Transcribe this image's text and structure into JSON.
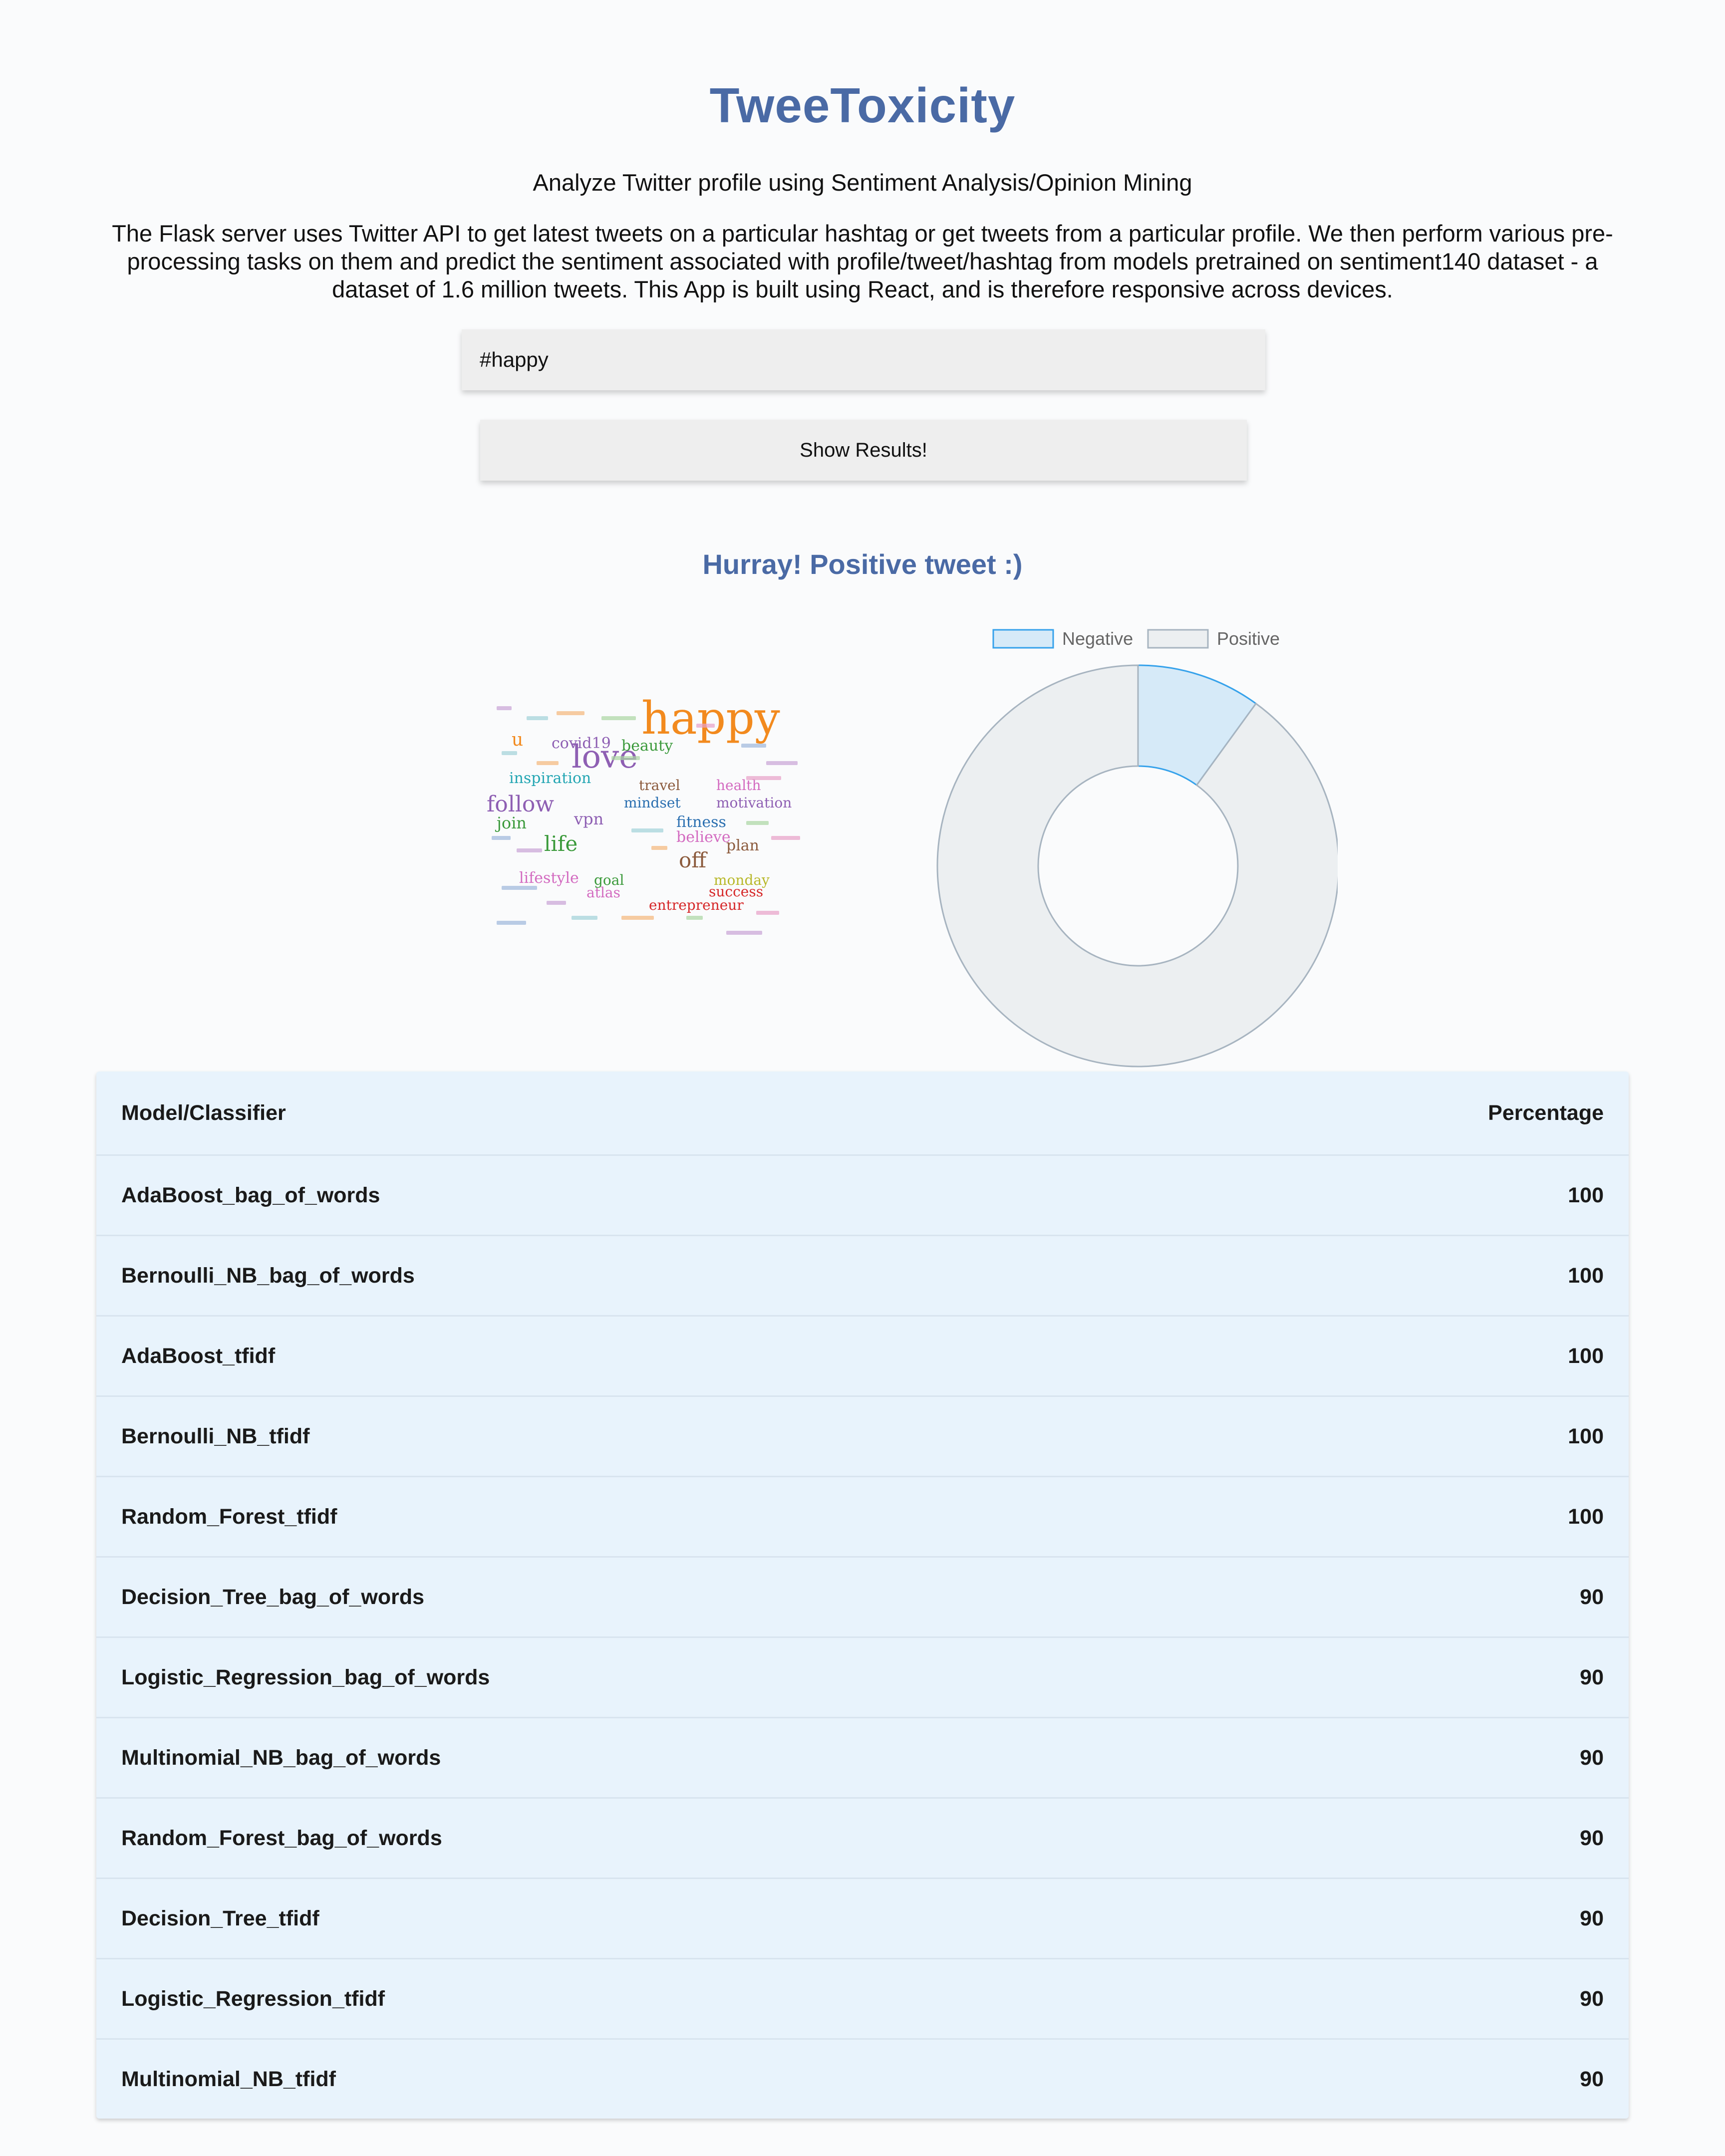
{
  "app": {
    "title": "TweeToxicity",
    "subtitle": "Analyze Twitter profile using Sentiment Analysis/Opinion Mining",
    "description": "The Flask server uses Twitter API to get latest tweets on a particular hashtag or get tweets from a particular profile. We then perform various pre-processing tasks on them and predict the sentiment associated with profile/tweet/hashtag from models pretrained on sentiment140 dataset - a dataset of 1.6 million tweets. This App is built using React, and is therefore responsive across devices."
  },
  "search": {
    "value": "#happy"
  },
  "actions": {
    "show_results_label": "Show Results!"
  },
  "result": {
    "heading": "Hurray! Positive tweet :)"
  },
  "wordcloud": {
    "words": [
      {
        "text": "happy",
        "color": "#f28a1e"
      },
      {
        "text": "love",
        "color": "#8e5fb3"
      },
      {
        "text": "covid19",
        "color": "#8e5fb3"
      },
      {
        "text": "beauty",
        "color": "#3b9a3b"
      },
      {
        "text": "inspiration",
        "color": "#24a6b3"
      },
      {
        "text": "follow",
        "color": "#8e5fb3"
      },
      {
        "text": "travel",
        "color": "#8b5a3c"
      },
      {
        "text": "health",
        "color": "#d36bc0"
      },
      {
        "text": "mindset",
        "color": "#2a6fb0"
      },
      {
        "text": "motivation",
        "color": "#8e5fb3"
      },
      {
        "text": "join",
        "color": "#3b9a3b"
      },
      {
        "text": "vpn",
        "color": "#8e5fb3"
      },
      {
        "text": "fitness",
        "color": "#2a6fb0"
      },
      {
        "text": "believe",
        "color": "#d36bc0"
      },
      {
        "text": "life",
        "color": "#3b9a3b"
      },
      {
        "text": "off",
        "color": "#8b5a3c"
      },
      {
        "text": "plan",
        "color": "#8b5a3c"
      },
      {
        "text": "lifestyle",
        "color": "#d36bc0"
      },
      {
        "text": "goal",
        "color": "#3b9a3b"
      },
      {
        "text": "monday",
        "color": "#b8b82a"
      },
      {
        "text": "atlas",
        "color": "#d36bc0"
      },
      {
        "text": "success",
        "color": "#d62728"
      },
      {
        "text": "entrepreneur",
        "color": "#d62728"
      },
      {
        "text": "u",
        "color": "#f28a1e"
      }
    ]
  },
  "colors": {
    "accent": "#4a6aa5",
    "negative_fill": "#d6eaf8",
    "negative_border": "#36a2eb",
    "positive_fill": "#eceff1",
    "positive_border": "#a7b4c0",
    "table_bg": "#e8f3fc"
  },
  "chart_data": {
    "type": "doughnut",
    "legend_position": "top",
    "labels": [
      "Negative",
      "Positive"
    ],
    "values": [
      1,
      9
    ]
  },
  "table": {
    "headers": [
      "Model/Classifier",
      "Percentage"
    ],
    "rows": [
      [
        "AdaBoost_bag_of_words",
        "100"
      ],
      [
        "Bernoulli_NB_bag_of_words",
        "100"
      ],
      [
        "AdaBoost_tfidf",
        "100"
      ],
      [
        "Bernoulli_NB_tfidf",
        "100"
      ],
      [
        "Random_Forest_tfidf",
        "100"
      ],
      [
        "Decision_Tree_bag_of_words",
        "90"
      ],
      [
        "Logistic_Regression_bag_of_words",
        "90"
      ],
      [
        "Multinomial_NB_bag_of_words",
        "90"
      ],
      [
        "Random_Forest_bag_of_words",
        "90"
      ],
      [
        "Decision_Tree_tfidf",
        "90"
      ],
      [
        "Logistic_Regression_tfidf",
        "90"
      ],
      [
        "Multinomial_NB_tfidf",
        "90"
      ]
    ]
  }
}
